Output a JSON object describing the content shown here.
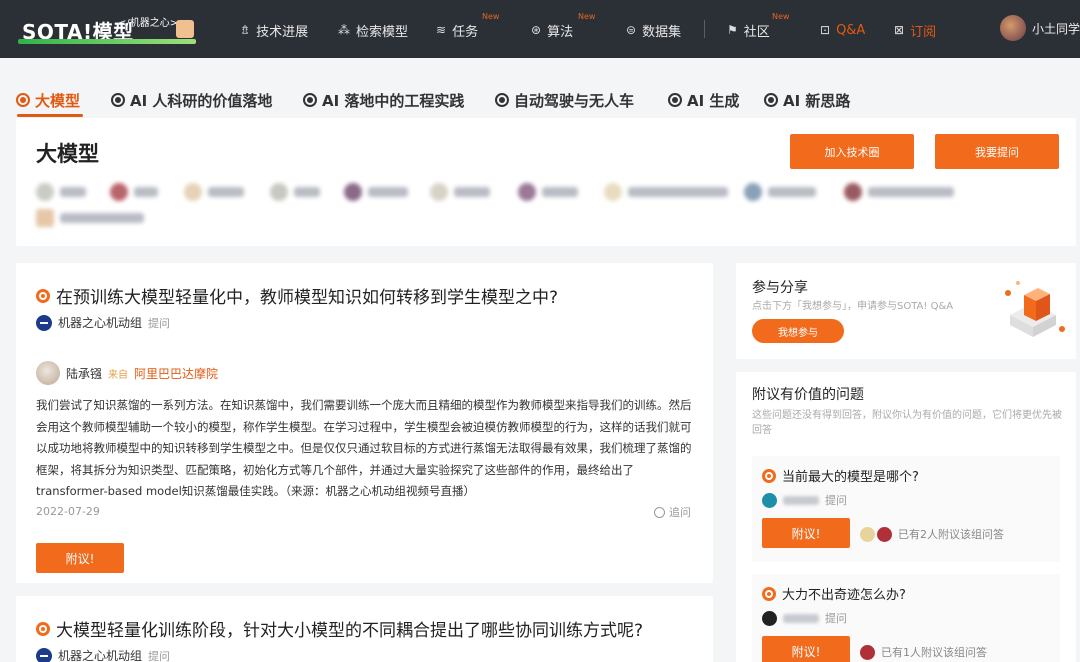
{
  "nav": {
    "logo_text": "SOTA!模型",
    "logo_tag": "</机器之心>",
    "items": [
      {
        "label": "技术进展",
        "icon": "rocket-icon",
        "glyph": "⇯"
      },
      {
        "label": "检索模型",
        "icon": "model-icon",
        "glyph": "⁂"
      },
      {
        "label": "任务",
        "icon": "layers-icon",
        "glyph": "≋",
        "badge": "New"
      },
      {
        "label": "算法",
        "icon": "algorithm-icon",
        "glyph": "⊛",
        "badge": "New"
      },
      {
        "label": "数据集",
        "icon": "database-icon",
        "glyph": "⊜"
      },
      {
        "label": "社区",
        "icon": "flag-icon",
        "glyph": "⚑",
        "badge": "New"
      },
      {
        "label": "Q&A",
        "icon": "qa-icon",
        "glyph": "⊡"
      },
      {
        "label": "订阅",
        "icon": "subscribe-icon",
        "glyph": "⊠"
      }
    ],
    "user_name": "小土同学"
  },
  "tabs": [
    {
      "label": "大模型",
      "icon": "large-model-icon"
    },
    {
      "label": "AI 人科研的价值落地",
      "icon": "ai-research-icon"
    },
    {
      "label": "AI 落地中的工程实践",
      "icon": "ai-engineering-icon"
    },
    {
      "label": "自动驾驶与无人车",
      "icon": "autonomous-driving-icon"
    },
    {
      "label": "AI 生成",
      "icon": "ai-generation-icon"
    },
    {
      "label": "AI 新思路",
      "icon": "ai-ideas-icon"
    }
  ],
  "header": {
    "title": "大模型",
    "join_button": "加入技术圈",
    "ask_button": "我要提问"
  },
  "question1": {
    "title": "在预训练大模型轻量化中，教师模型知识如何转移到学生模型之中?",
    "asker_org": "机器之心机动组",
    "asker_action": "提问",
    "answerer_name": "陆承镪",
    "answerer_role": "来自",
    "answerer_org": "阿里巴巴达摩院",
    "answer_text": "我们尝试了知识蒸馏的一系列方法。在知识蒸馏中，我们需要训练一个庞大而且精细的模型作为教师模型来指导我们的训练。然后会用这个教师模型辅助一个较小的模型，称作学生模型。在学习过程中，学生模型会被迫模仿教师模型的行为，这样的话我们就可以成功地将教师模型中的知识转移到学生模型之中。但是仅仅只通过软目标的方式进行蒸馏无法取得最有效果，我们梳理了蒸馏的框架，将其拆分为知识类型、匹配策略，初始化方式等几个部件，并通过大量实验探究了这些部件的作用，最终给出了transformer-based model知识蒸馏最佳实践。（来源：机器之心机动组视频号直播）",
    "date": "2022-07-29",
    "reply_label": "追问",
    "second_button": "附议!"
  },
  "question2": {
    "title": "大模型轻量化训练阶段，针对大小模型的不同耦合提出了哪些协同训练方式呢?",
    "asker_org": "机器之心机动组",
    "asker_action": "提问"
  },
  "sidebar": {
    "participate_title": "参与分享",
    "participate_sub": "点击下方「我想参与」，申请参与SOTA! Q&A",
    "participate_button": "我想参与",
    "valuable_title": "附议有价值的问题",
    "valuable_sub": "这些问题还没有得到回答，附议你认为有价值的问题，它们将更优先被回答",
    "questions": [
      {
        "title": "当前最大的模型是哪个?",
        "asker_action": "提问",
        "button": "附议!",
        "meta": "已有2人附议该组问答"
      },
      {
        "title": "大力不出奇迹怎么办?",
        "asker_action": "提问",
        "button": "附议!",
        "meta": "已有1人附议该组问答"
      }
    ]
  },
  "colors": {
    "accent": "#f26b1d",
    "nav_bg": "#2b2f36",
    "page_bg": "#f4f5f7"
  }
}
